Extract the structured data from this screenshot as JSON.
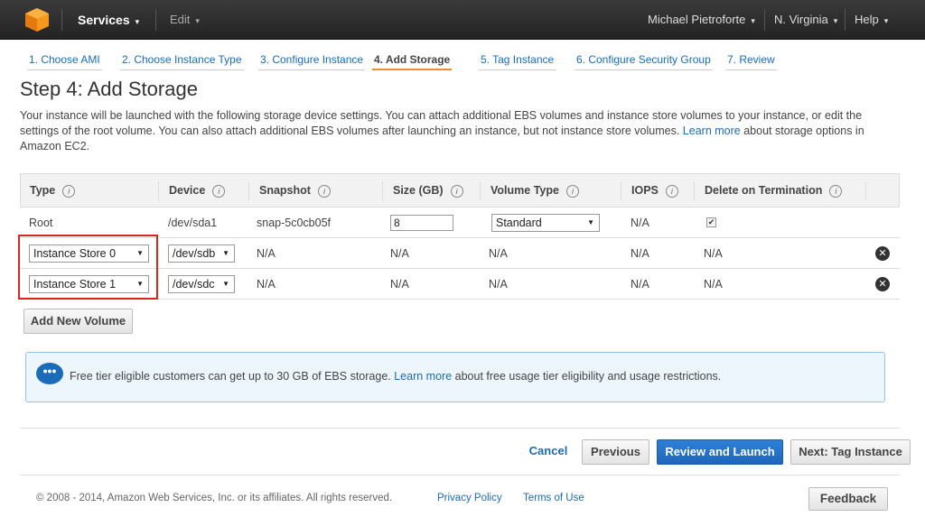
{
  "topbar": {
    "services_label": "Services",
    "edit_label": "Edit",
    "user_label": "Michael Pietroforte",
    "region_label": "N. Virginia",
    "help_label": "Help"
  },
  "wizard_tabs": [
    {
      "label": "1. Choose AMI"
    },
    {
      "label": "2. Choose Instance Type"
    },
    {
      "label": "3. Configure Instance"
    },
    {
      "label": "4. Add Storage"
    },
    {
      "label": "5. Tag Instance"
    },
    {
      "label": "6. Configure Security Group"
    },
    {
      "label": "7. Review"
    }
  ],
  "page_title": "Step 4: Add Storage",
  "description": {
    "text": "Your instance will be launched with the following storage device settings. You can attach additional EBS volumes and instance store volumes to your instance, or edit the settings of the root volume. You can also attach additional EBS volumes after launching an instance, but not instance store volumes.",
    "link": "Learn more",
    "suffix": "about storage options in Amazon EC2."
  },
  "table": {
    "headers": [
      "Type",
      "Device",
      "Snapshot",
      "Size (GB)",
      "Volume Type",
      "IOPS",
      "Delete on Termination"
    ],
    "info_icon": "i",
    "root_row": {
      "type": "Root",
      "device": "/dev/sda1",
      "snapshot": "snap-5c0cb05f",
      "size": "8",
      "volume_type": "Standard",
      "iops": "N/A",
      "delete_on_termination": "✔"
    },
    "store_rows": [
      {
        "type": "Instance Store 0",
        "device": "/dev/sdb",
        "snapshot": "N/A",
        "size": "N/A",
        "volume_type": "N/A",
        "iops": "N/A",
        "delete_on_termination": "N/A"
      },
      {
        "type": "Instance Store 1",
        "device": "/dev/sdc",
        "snapshot": "N/A",
        "size": "N/A",
        "volume_type": "N/A",
        "iops": "N/A",
        "delete_on_termination": "N/A"
      }
    ]
  },
  "add_volume_label": "Add New Volume",
  "notice": {
    "text": "Free tier eligible customers can get up to 30 GB of EBS storage.",
    "link": "Learn more",
    "suffix": "about free usage tier eligibility and usage restrictions."
  },
  "actions": {
    "cancel": "Cancel",
    "previous": "Previous",
    "review_launch": "Review and Launch",
    "next": "Next: Tag Instance"
  },
  "footer": {
    "copyright": "© 2008 - 2014, Amazon Web Services, Inc. or its affiliates. All rights reserved.",
    "privacy": "Privacy Policy",
    "terms": "Terms of Use",
    "feedback": "Feedback"
  },
  "icons": {
    "dropdown_caret": "▾",
    "select_arrow": "▼",
    "remove": "✕",
    "chat": "•••"
  }
}
